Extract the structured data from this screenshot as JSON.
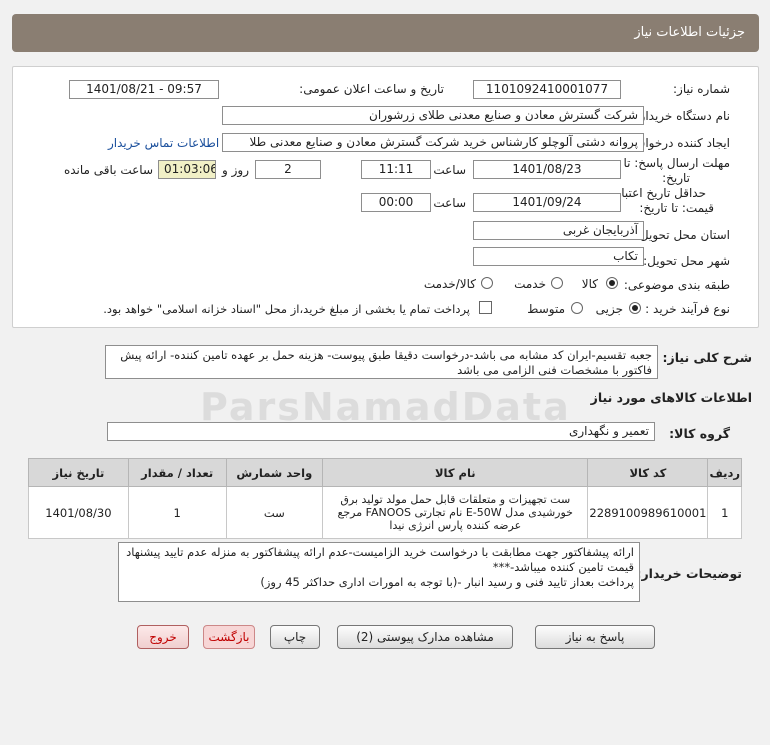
{
  "title": "جزئیات اطلاعات نیاز",
  "need_number": {
    "label": "شماره نیاز:",
    "value": "1101092410001077"
  },
  "announce": {
    "label": "تاریخ و ساعت اعلان عمومی:",
    "value": "1401/08/21 - 09:57"
  },
  "buyer_org": {
    "label": "نام دستگاه خریدار:",
    "value": "شرکت گسترش معادن و صنایع معدنی طلای زرشوران"
  },
  "requester": {
    "label": "ایجاد کننده درخواست:",
    "value": "پروانه  دشتی آلوچلو کارشناس خرید شرکت گسترش معادن و صنایع معدنی طلا",
    "contact_link": "اطلاعات تماس خریدار"
  },
  "reply_deadline": {
    "label_line1": "مهلت ارسال پاسخ: تا",
    "label_line2": "تاریخ:",
    "date": "1401/08/23",
    "time_label": "ساعت",
    "time": "11:11",
    "days": "2",
    "days_label": "روز و",
    "remaining": "01:03:06",
    "remaining_label": "ساعت باقی مانده"
  },
  "price_validity": {
    "label_line1": "حداقل تاریخ اعتبار",
    "label_line2": "قیمت: تا تاریخ:",
    "date": "1401/09/24",
    "time_label": "ساعت",
    "time": "00:00"
  },
  "province": {
    "label": "استان محل تحویل:",
    "value": "آذربایجان غربی"
  },
  "city": {
    "label": "شهر محل تحویل:",
    "value": "تکاب"
  },
  "category": {
    "label": "طبقه بندی موضوعی:",
    "options": [
      "کالا",
      "خدمت",
      "کالا/خدمت"
    ],
    "selected": "کالا"
  },
  "purchase_type": {
    "label": "نوع فرآیند خرید :",
    "options": [
      "جزیی",
      "متوسط"
    ],
    "selected": "جزیی",
    "checkbox_text": "پرداخت تمام یا بخشی از مبلغ خرید،از محل \"اسناد خزانه اسلامی\" خواهد بود."
  },
  "general_desc": {
    "label": "شرح کلی نیاز:",
    "text": "جعبه تقسیم-ایران کد مشابه می باشد-درخواست دقیقا طبق پیوست- هزینه حمل بر عهده تامین کننده- ارائه پیش فاکتور با مشخصات فنی الزامی می باشد"
  },
  "goods_info_title": "اطلاعات کالاهای مورد نیاز",
  "goods_group": {
    "label": "گروه کالا:",
    "value": "تعمیر و نگهداری"
  },
  "table": {
    "headers": [
      "ردیف",
      "کد کالا",
      "نام کالا",
      "واحد شمارش",
      "تعداد / مقدار",
      "تاریخ نیاز"
    ],
    "rows": [
      {
        "index": "1",
        "code": "2289100989610001",
        "name": "ست تجهیزات و متعلقات قابل حمل مولد تولید برق خورشیدی مدل E-50W نام تجارتی FANOOS مرجع عرضه کننده پارس انرژی نیدا",
        "unit": "ست",
        "qty": "1",
        "date": "1401/08/30"
      }
    ]
  },
  "buyer_notes": {
    "label": "توضیحات خریدار:",
    "text": "ارائه پیشفاکتور جهت مطابقت با درخواست خرید الزامیست-عدم ارائه پیشفاکتور به منزله عدم تایید پیشنهاد قیمت تامین کننده میباشد-***\nپرداخت بعداز تایید فنی و رسید انبار -(با توجه به امورات اداری حداکثر 45 روز)"
  },
  "buttons": {
    "reply": "پاسخ به نیاز",
    "attachments": "مشاهده مدارک پیوستی (2)",
    "print": "چاپ",
    "back": "بازگشت",
    "exit": "خروج"
  },
  "watermark": "ParsNamadData"
}
